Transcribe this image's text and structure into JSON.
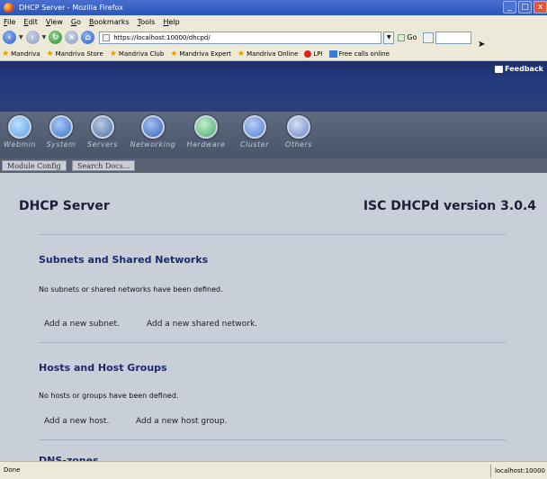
{
  "window": {
    "title": "DHCP Server - Mozilla Firefox",
    "minimize": "_",
    "maximize": "□",
    "close": "x"
  },
  "menubar": [
    "File",
    "Edit",
    "View",
    "Go",
    "Bookmarks",
    "Tools",
    "Help"
  ],
  "navbar": {
    "url": "https://localhost:10000/dhcpd/",
    "go_label": "Go"
  },
  "bookmarks": [
    {
      "label": "Mandriva",
      "icon": "star-icon"
    },
    {
      "label": "Mandriva Store",
      "icon": "star-icon"
    },
    {
      "label": "Mandriva Club",
      "icon": "star-icon"
    },
    {
      "label": "Mandriva Expert",
      "icon": "star-icon"
    },
    {
      "label": "Mandriva Online",
      "icon": "star-icon"
    },
    {
      "label": "LPI",
      "icon": "lpi-icon"
    },
    {
      "label": "Free calls online",
      "icon": "phone-icon"
    }
  ],
  "webmin": {
    "feedback_label": "Feedback",
    "categories": [
      {
        "label": "Webmin",
        "icon": "webmin-icon",
        "color": "#5aa0e8"
      },
      {
        "label": "System",
        "icon": "system-icon",
        "color": "#3c73c9"
      },
      {
        "label": "Servers",
        "icon": "servers-icon",
        "color": "#4b6fa8"
      },
      {
        "label": "Networking",
        "icon": "networking-icon",
        "color": "#3a64b8"
      },
      {
        "label": "Hardware",
        "icon": "hardware-icon",
        "color": "#4aa86b"
      },
      {
        "label": "Cluster",
        "icon": "cluster-icon",
        "color": "#4f7dd6"
      },
      {
        "label": "Others",
        "icon": "others-icon",
        "color": "#6b86c4"
      }
    ],
    "module_config": "Module Config",
    "search_docs": "Search Docs..."
  },
  "main": {
    "title": "DHCP Server",
    "version": "ISC DHCPd version 3.0.4",
    "sections": [
      {
        "title": "Subnets and Shared Networks",
        "message": "No subnets or shared networks have been defined.",
        "links": [
          "Add a new subnet.",
          "Add a new shared network."
        ]
      },
      {
        "title": "Hosts and Host Groups",
        "message": "No hosts or groups have been defined.",
        "links": [
          "Add a new host.",
          "Add a new host group."
        ]
      },
      {
        "title": "DNS-zones",
        "message": "",
        "links": []
      }
    ]
  },
  "statusbar": {
    "status": "Done",
    "host": "localhost:10000"
  }
}
